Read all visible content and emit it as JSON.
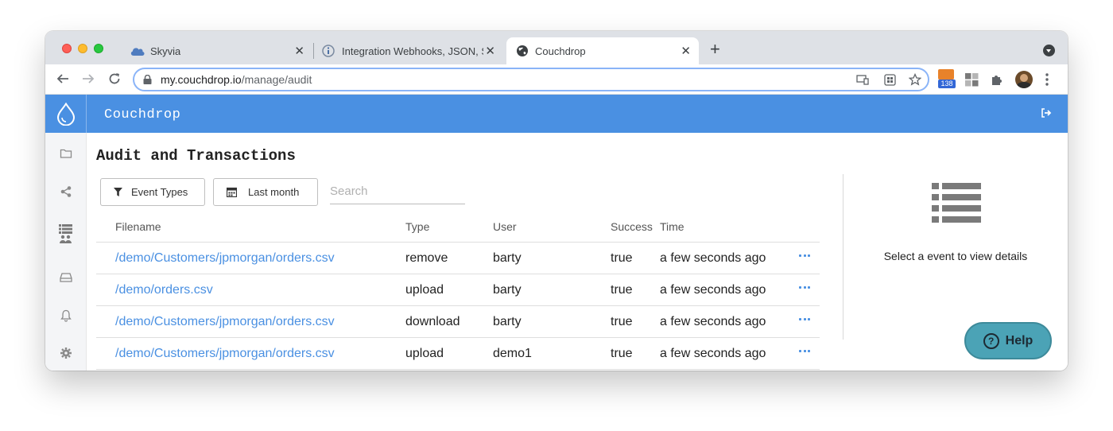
{
  "browser": {
    "tabs": [
      {
        "title": "Skyvia",
        "icon": "cloud-icon",
        "close": "✕"
      },
      {
        "title": "Integration Webhooks, JSON, S",
        "icon": "info-icon",
        "close": "✕"
      },
      {
        "title": "Couchdrop",
        "icon": "globe-icon",
        "close": "✕"
      }
    ],
    "new_tab": "+",
    "url_host": "my.couchdrop.io",
    "url_path": "/manage/audit",
    "extension_badge": "138"
  },
  "app": {
    "brand": "Couchdrop",
    "accent_color": "#4a90e2",
    "page_title": "Audit and Transactions",
    "filters": {
      "event_types": "Event Types",
      "date_range": "Last month"
    },
    "search": {
      "placeholder": "Search"
    },
    "table": {
      "columns": [
        "Filename",
        "Type",
        "User",
        "Success",
        "Time"
      ],
      "rows": [
        [
          "/demo/Customers/jpmorgan/orders.csv",
          "remove",
          "barty",
          "true",
          "a few seconds ago"
        ],
        [
          "/demo/orders.csv",
          "upload",
          "barty",
          "true",
          "a few seconds ago"
        ],
        [
          "/demo/Customers/jpmorgan/orders.csv",
          "download",
          "barty",
          "true",
          "a few seconds ago"
        ],
        [
          "/demo/Customers/jpmorgan/orders.csv",
          "upload",
          "demo1",
          "true",
          "a few seconds ago"
        ]
      ]
    },
    "details_placeholder": "Select a event to view details",
    "help_label": "Help",
    "help_icon": "?"
  }
}
